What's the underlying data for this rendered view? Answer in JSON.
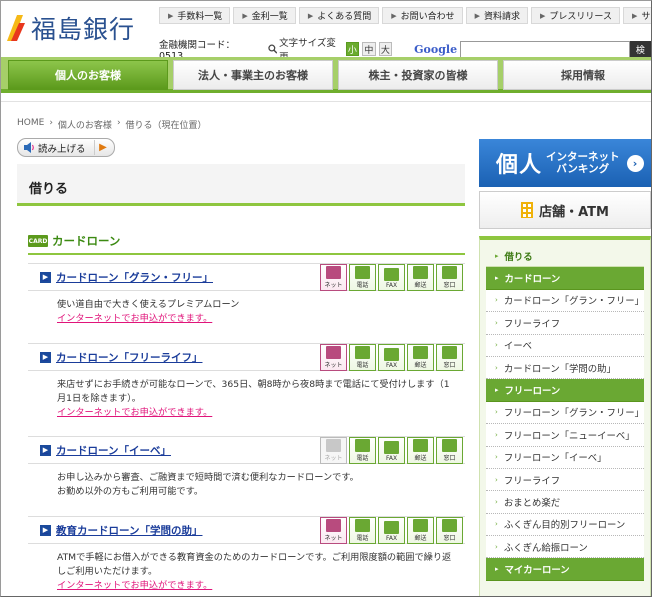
{
  "header": {
    "logo_text": "福島銀行",
    "utility_links": [
      "手数料一覧",
      "金利一覧",
      "よくある質問",
      "お問い合わせ",
      "資料請求",
      "プレスリリース",
      "サイトマップ"
    ],
    "bank_code": "金融機関コード：0513",
    "font_size_label": "文字サイズ変更",
    "font_size_options": [
      "小",
      "中",
      "大"
    ],
    "search_engine_label": "Google",
    "search_button": "検"
  },
  "global_nav": [
    {
      "label": "個人のお客様",
      "active": true
    },
    {
      "label": "法人・事業主のお客様",
      "active": false
    },
    {
      "label": "株主・投資家の皆様",
      "active": false
    },
    {
      "label": "採用情報",
      "active": false
    }
  ],
  "breadcrumb": [
    "HOME",
    "個人のお客様",
    "借りる（現在位置）"
  ],
  "read_aloud_label": "読み上げる",
  "page_title": "借りる",
  "section": {
    "badge": "CARD",
    "title": "カードローン"
  },
  "channel_labels": [
    "ネット",
    "電話",
    "FAX",
    "郵送",
    "窓口"
  ],
  "products": [
    {
      "name": "カードローン「グラン・フリー」",
      "net_available": true,
      "description": "使い道自由で大きく使えるプレミアムローン",
      "apply_text": "インターネットでお申込ができます。"
    },
    {
      "name": "カードローン「フリーライフ」",
      "net_available": true,
      "description": "来店せずにお手続きが可能なローンで、365日、朝8時から夜8時まで電話にて受付けします（1月1日を除きます）。",
      "apply_text": "インターネットでお申込ができます。"
    },
    {
      "name": "カードローン「イーベ」",
      "net_available": false,
      "description": "お申し込みから審査、ご融資まで短時間で済む便利なカードローンです。\nお勤め以外の方もご利用可能です。",
      "apply_text": ""
    },
    {
      "name": "教育カードローン「学問の助」",
      "net_available": true,
      "description": "ATMで手軽にお借入ができる教育資金のためのカードローンです。ご利用限度額の範囲で繰り返しご利用いただけます。",
      "apply_text": "インターネットでお申込ができます。"
    }
  ],
  "banners": {
    "ib_big": "個人",
    "ib_small_1": "インターネット",
    "ib_small_2": "バンキング",
    "store": "店舗・ATM"
  },
  "local_nav": [
    {
      "label": "借りる",
      "type": "top"
    },
    {
      "label": "カードローン",
      "type": "cat"
    },
    {
      "label": "カードローン「グラン・フリー」",
      "type": "item"
    },
    {
      "label": "フリーライフ",
      "type": "item"
    },
    {
      "label": "イーベ",
      "type": "item"
    },
    {
      "label": "カードローン「学問の助」",
      "type": "item"
    },
    {
      "label": "フリーローン",
      "type": "cat"
    },
    {
      "label": "フリーローン「グラン・フリー」",
      "type": "item"
    },
    {
      "label": "フリーローン「ニューイーベ」",
      "type": "item"
    },
    {
      "label": "フリーローン「イーベ」",
      "type": "item"
    },
    {
      "label": "フリーライフ",
      "type": "item"
    },
    {
      "label": "おまとめ楽だ",
      "type": "item"
    },
    {
      "label": "ふくぎん目的別フリーローン",
      "type": "item"
    },
    {
      "label": "ふくぎん給振ローン",
      "type": "item"
    },
    {
      "label": "マイカーローン",
      "type": "cat"
    }
  ],
  "colors": {
    "brand_green": "#6fae2d",
    "brand_blue": "#2a5190",
    "link_blue": "#1a3c9a",
    "apply_pink": "#e0147a",
    "net_magenta": "#b84b7e"
  }
}
